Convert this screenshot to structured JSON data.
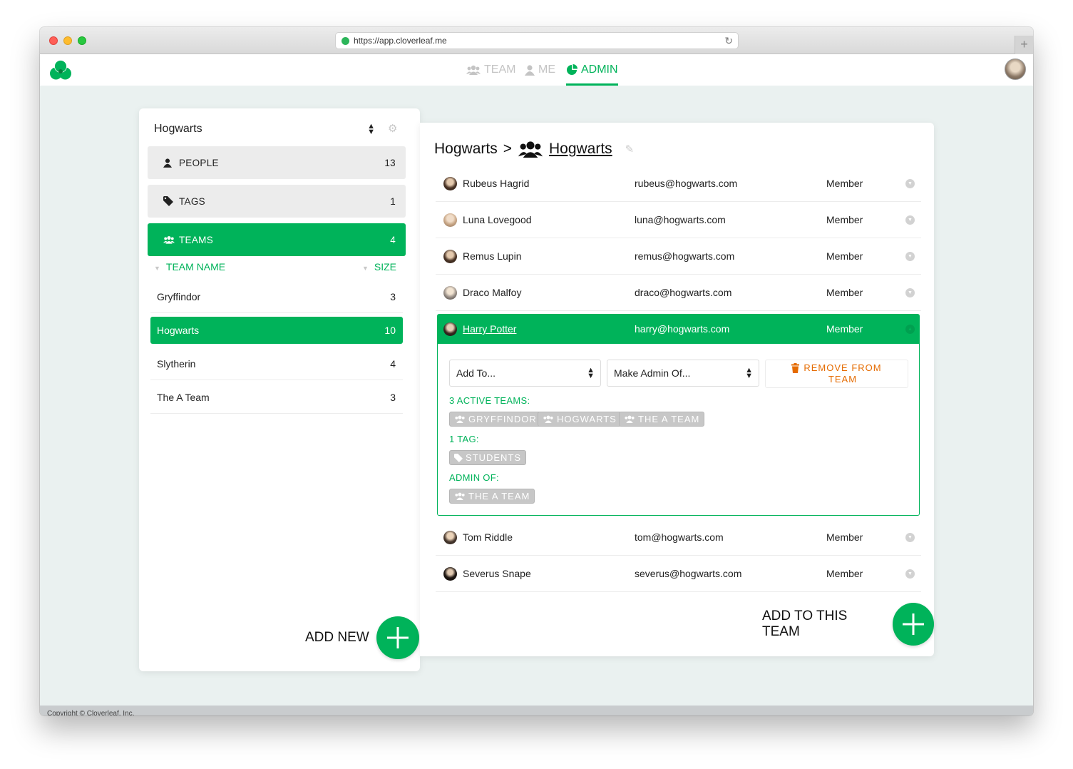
{
  "browser": {
    "url": "https://app.cloverleaf.me",
    "new_tab": "+"
  },
  "nav": {
    "tabs": [
      {
        "label": "TEAM",
        "icon": "users-icon"
      },
      {
        "label": "ME",
        "icon": "user-icon"
      },
      {
        "label": "ADMIN",
        "icon": "pie-chart-icon"
      }
    ],
    "active_tab": "ADMIN",
    "accent_color": "#00b35a"
  },
  "sidebar": {
    "org_select": "Hogwarts",
    "menu": [
      {
        "label": "PEOPLE",
        "count": "13",
        "icon": "user-icon"
      },
      {
        "label": "TAGS",
        "count": "1",
        "icon": "tag-icon"
      },
      {
        "label": "TEAMS",
        "count": "4",
        "icon": "users-icon"
      }
    ],
    "columns": {
      "name": "TEAM NAME",
      "size": "SIZE"
    },
    "teams": [
      {
        "name": "Gryffindor",
        "size": "3"
      },
      {
        "name": "Hogwarts",
        "size": "10"
      },
      {
        "name": "Slytherin",
        "size": "4"
      },
      {
        "name": "The A Team",
        "size": "3"
      }
    ],
    "selected_team": "Hogwarts",
    "add_new_label": "ADD NEW"
  },
  "team_detail": {
    "breadcrumb_org": "Hogwarts",
    "breadcrumb_sep": ">",
    "team_name": "Hogwarts",
    "members": [
      {
        "name": "Rubeus Hagrid",
        "email": "rubeus@hogwarts.com",
        "role": "Member"
      },
      {
        "name": "Luna Lovegood",
        "email": "luna@hogwarts.com",
        "role": "Member"
      },
      {
        "name": "Remus Lupin",
        "email": "remus@hogwarts.com",
        "role": "Member"
      },
      {
        "name": "Draco Malfoy",
        "email": "draco@hogwarts.com",
        "role": "Member"
      },
      {
        "name": "Harry Potter",
        "email": "harry@hogwarts.com",
        "role": "Member"
      },
      {
        "name": "Tom Riddle",
        "email": "tom@hogwarts.com",
        "role": "Member"
      },
      {
        "name": "Severus Snape",
        "email": "severus@hogwarts.com",
        "role": "Member"
      }
    ],
    "expanded_member": "Harry Potter",
    "detail": {
      "add_to": "Add To...",
      "make_admin": "Make Admin Of...",
      "remove_line1": "REMOVE FROM",
      "remove_line2": "TEAM",
      "active_teams_label": "3 ACTIVE TEAMS:",
      "active_teams": [
        "GRYFFINDOR",
        "HOGWARTS",
        "THE A TEAM"
      ],
      "tags_label": "1 TAG:",
      "tags": [
        "STUDENTS"
      ],
      "admin_label": "ADMIN OF:",
      "admin_of": [
        "THE A TEAM"
      ]
    },
    "add_to_team_label": "ADD TO THIS TEAM"
  },
  "footer": {
    "text": "Copyright © Cloverleaf, Inc."
  }
}
